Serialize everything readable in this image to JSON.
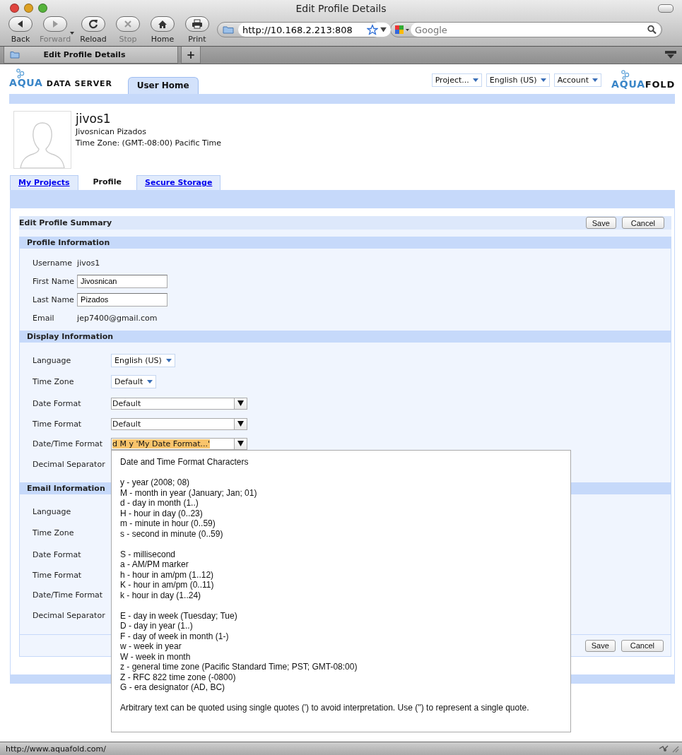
{
  "window": {
    "title": "Edit Profile Details"
  },
  "toolbar": {
    "buttons": [
      {
        "label": "Back",
        "kind": "back",
        "disabled": false
      },
      {
        "label": "Forward",
        "kind": "forward",
        "disabled": true
      },
      {
        "label": "Reload",
        "kind": "reload",
        "disabled": false
      },
      {
        "label": "Stop",
        "kind": "stop",
        "disabled": true
      },
      {
        "label": "Home",
        "kind": "home",
        "disabled": false
      },
      {
        "label": "Print",
        "kind": "print",
        "disabled": false
      }
    ],
    "address": "http://10.168.2.213:808",
    "search": {
      "placeholder": "Google"
    }
  },
  "browser_tabs": [
    {
      "label": "Edit Profile Details",
      "selected": true
    }
  ],
  "new_tab": "+",
  "app": {
    "logo": {
      "accent": "AQUA",
      "rest": "DATA SERVER"
    },
    "nav_tabs": [
      {
        "label": "User Home",
        "selected": true
      }
    ],
    "menus": [
      "Project...",
      "English (US)",
      "Account"
    ],
    "brand": {
      "accent": "AQUA",
      "rest": "FOLD"
    }
  },
  "user": {
    "username": "jivos1",
    "full_name": "Jivosnican Pizados",
    "time_zone": "Time Zone: (GMT:-08:00) Pacific Time"
  },
  "profile_tabs": [
    {
      "label": "My Projects",
      "selected": false
    },
    {
      "label": "Profile",
      "selected": true
    },
    {
      "label": "Secure Storage",
      "selected": false
    }
  ],
  "panel": {
    "title": "Edit Profile Summary",
    "buttons": [
      "Save",
      "Cancel"
    ],
    "sections": [
      {
        "title": "Profile Information",
        "rows": [
          {
            "label": "Username",
            "kind": "text",
            "value": "jivos1"
          },
          {
            "label": "First Name",
            "kind": "input",
            "value": "Jivosnican"
          },
          {
            "label": "Last Name",
            "kind": "input",
            "value": "Pizados"
          },
          {
            "label": "Email",
            "kind": "text",
            "value": "jep7400@gmail.com"
          }
        ]
      },
      {
        "title": "Display Information",
        "rows": [
          {
            "label": "Language",
            "kind": "compact",
            "value": "English (US)",
            "highlighted": false
          },
          {
            "label": "Time Zone",
            "kind": "compact",
            "value": "Default",
            "highlighted": false
          },
          {
            "label": "Date Format",
            "kind": "wide",
            "value": "Default",
            "highlighted": false
          },
          {
            "label": "Time Format",
            "kind": "wide",
            "value": "Default",
            "highlighted": false
          },
          {
            "label": "Date/Time Format",
            "kind": "wide",
            "value": "d M y 'My Date Format...'",
            "highlighted": true
          },
          {
            "label": "Decimal Separator"
          }
        ]
      },
      {
        "title": "Email Information",
        "rows": [
          {
            "label": "Language"
          },
          {
            "label": "Time Zone"
          },
          {
            "label": "Date Format"
          },
          {
            "label": "Time Format"
          },
          {
            "label": "Date/Time Format"
          },
          {
            "label": "Decimal Separator"
          }
        ]
      }
    ],
    "footer_buttons": [
      "Save",
      "Cancel"
    ]
  },
  "popup": {
    "title": "Date and Time Format Characters",
    "groups": [
      [
        "y - year (2008; 08)",
        "M - month in year (January; Jan; 01)",
        "d - day in month (1..)",
        "H - hour in day (0..23)",
        "m - minute in hour (0..59)",
        "s - second in minute (0..59)"
      ],
      [
        "S - millisecond",
        "a - AM/PM marker",
        "h - hour in am/pm (1..12)",
        "K - hour in am/pm (0..11)",
        "k - hour in day (1..24)"
      ],
      [
        "E - day in week (Tuesday; Tue)",
        "D - day in year (1..)",
        "F - day of week in month (1-)",
        "w - week in year",
        "W - week in month",
        "z - general time zone (Pacific Standard Time; PST; GMT-08:00)",
        "Z - RFC 822 time zone (-0800)",
        "G - era designator (AD, BC)"
      ]
    ],
    "note": "Arbitrary text can be quoted using single quotes (') to avoid interpretation. Use ('') to represent a single quote."
  },
  "status_bar": "http://www.aquafold.com/"
}
